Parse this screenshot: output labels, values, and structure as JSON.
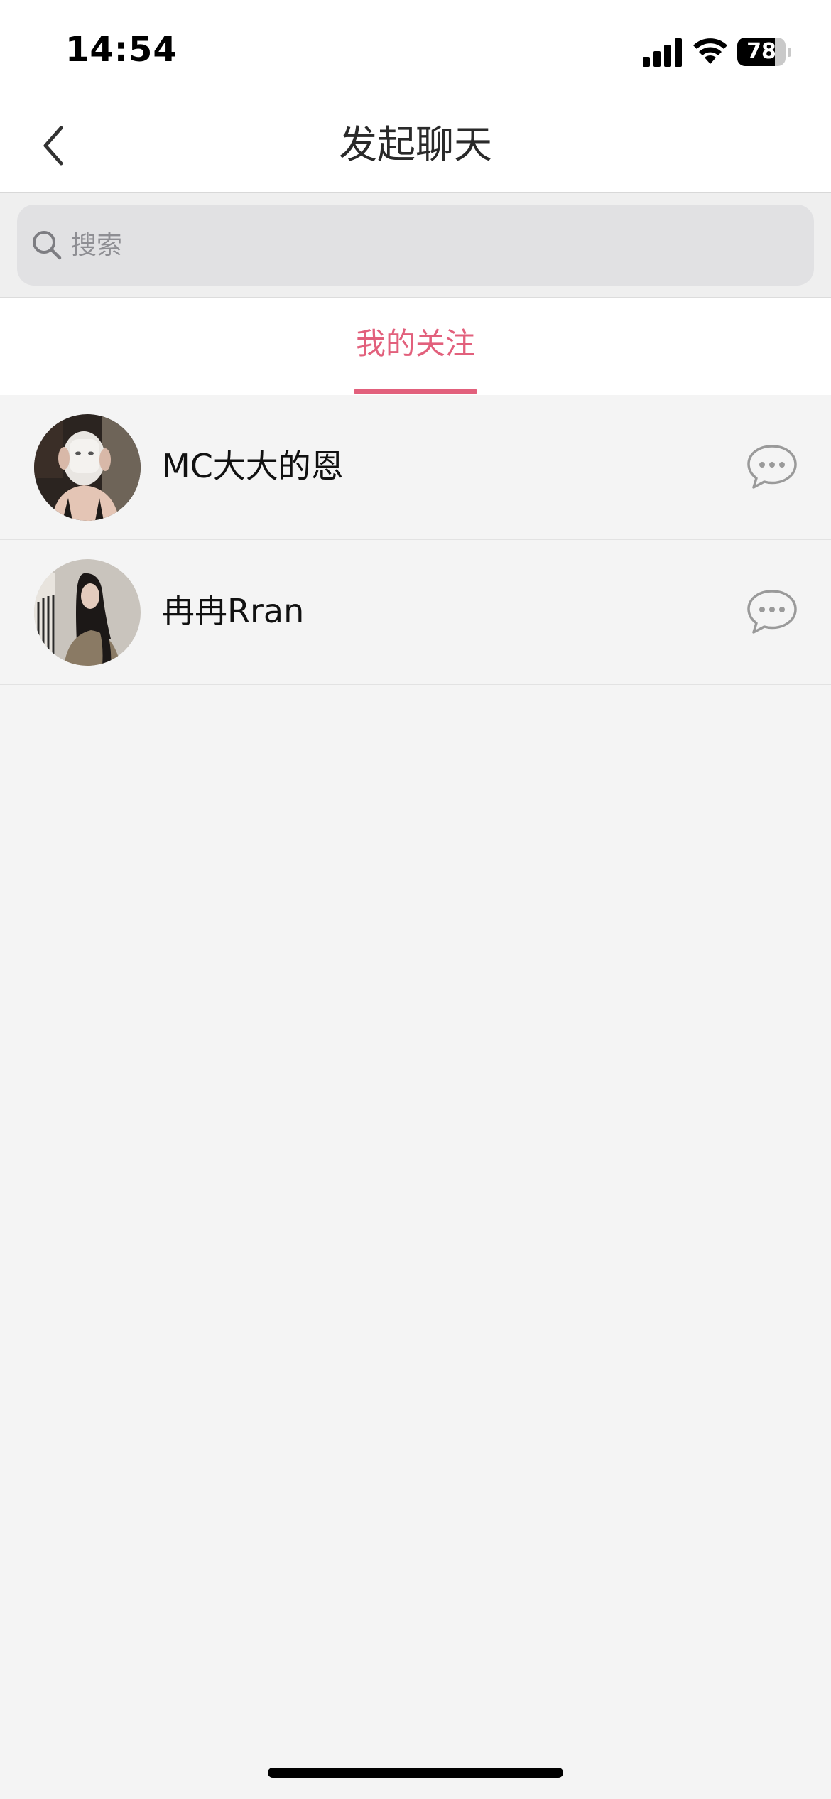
{
  "status_bar": {
    "time": "14:54",
    "battery_level": "78",
    "battery_fraction": 0.78
  },
  "nav": {
    "title": "发起聊天",
    "back_icon": "chevron-left-icon"
  },
  "search": {
    "placeholder": "搜索",
    "value": "",
    "icon": "search-icon"
  },
  "tabs": [
    {
      "label": "我的关注",
      "active": true
    }
  ],
  "contacts": [
    {
      "name": "MC大大的恩",
      "action_icon": "chat-bubble-icon"
    },
    {
      "name": "冉冉Rran",
      "action_icon": "chat-bubble-icon"
    }
  ],
  "colors": {
    "accent": "#e2607c",
    "background": "#f4f4f4",
    "search_box": "#e1e1e3"
  }
}
